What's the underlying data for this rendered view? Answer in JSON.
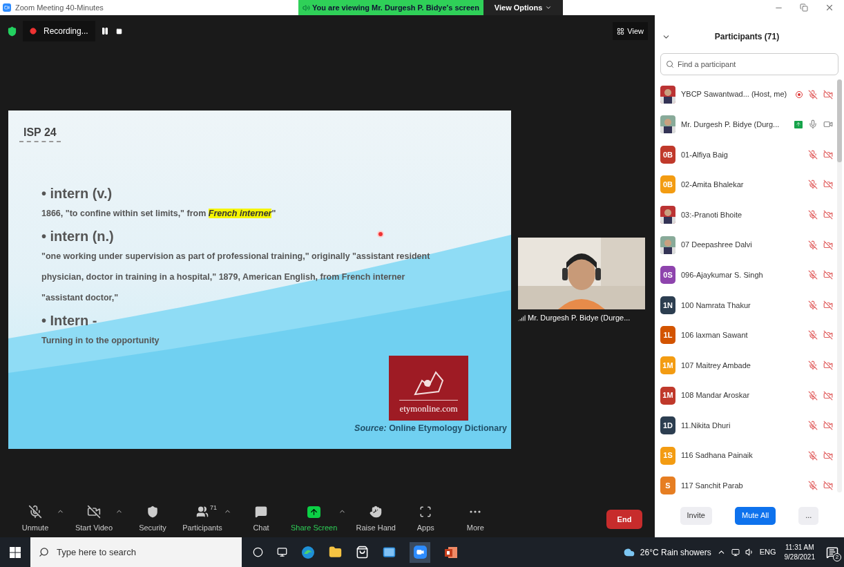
{
  "window": {
    "title": "Zoom Meeting 40-Minutes"
  },
  "banner": {
    "text": "You are viewing Mr. Durgesh P. Bidye's screen",
    "view_options": "View Options"
  },
  "meeting_bar": {
    "recording": "Recording...",
    "view": "View"
  },
  "slide": {
    "tag": "ISP 24",
    "blocks": [
      {
        "kind": "heading",
        "text": "• intern (v.)"
      },
      {
        "kind": "para",
        "before": "1866, \"to confine within set limits,\" from ",
        "highlight": "French interner",
        "after": "\""
      },
      {
        "kind": "heading",
        "text": "• intern (n.)"
      },
      {
        "kind": "para",
        "before": "\"one working under supervision as part of professional training,\" originally \"assistant resident physician, doctor in training in a hospital,\" 1879, American English, from French interner \"assistant doctor,\""
      },
      {
        "kind": "heading",
        "text": "• Intern -"
      },
      {
        "kind": "para",
        "before": "Turning in to the opportunity"
      }
    ],
    "logo_text": "etymonline.com",
    "source": "*Source:* Online Etymology Dictionary"
  },
  "video_tile": {
    "name": "Mr. Durgesh P. Bidye (Durge..."
  },
  "toolbar": [
    {
      "kind": "unmute",
      "label": "Unmute",
      "caret": true
    },
    {
      "kind": "video",
      "label": "Start Video",
      "caret": true
    },
    {
      "kind": "security",
      "label": "Security",
      "caret": false
    },
    {
      "kind": "participants",
      "label": "Participants",
      "count": "71",
      "caret": true
    },
    {
      "kind": "chat",
      "label": "Chat",
      "caret": false
    },
    {
      "kind": "share",
      "label": "Share Screen",
      "caret": true
    },
    {
      "kind": "hand",
      "label": "Raise Hand",
      "caret": false
    },
    {
      "kind": "apps",
      "label": "Apps",
      "caret": false
    },
    {
      "kind": "more",
      "label": "More",
      "caret": false
    }
  ],
  "end_button": "End",
  "participants": {
    "title": "Participants (71)",
    "search": {
      "placeholder": "Find a participant"
    },
    "items": [
      {
        "name": "YBCP Sawantwad... (Host, me)",
        "recording": true,
        "sharing": false,
        "muted": true,
        "video_off": true
      },
      {
        "name": "Mr. Durgesh P. Bidye (Durg...",
        "recording": false,
        "sharing": true,
        "muted": false,
        "video_off": false
      },
      {
        "name": "01-Alfiya Baig",
        "kind": "initials",
        "initials": "0B",
        "color": "#c0392b",
        "recording": false,
        "sharing": false,
        "muted": true,
        "video_off": true
      },
      {
        "name": "02-Amita Bhalekar",
        "kind": "initials",
        "initials": "0B",
        "color": "#f39c12",
        "recording": false,
        "sharing": false,
        "muted": true,
        "video_off": true
      },
      {
        "name": "03:-Pranoti Bhoite",
        "recording": false,
        "sharing": false,
        "muted": true,
        "video_off": true
      },
      {
        "name": "07 Deepashree Dalvi",
        "recording": false,
        "sharing": false,
        "muted": true,
        "video_off": true
      },
      {
        "name": "096-Ajaykumar S. Singh",
        "kind": "initials",
        "initials": "0S",
        "color": "#8e44ad",
        "recording": false,
        "sharing": false,
        "muted": true,
        "video_off": true
      },
      {
        "name": "100 Namrata Thakur",
        "kind": "initials",
        "initials": "1N",
        "color": "#2c3e50",
        "recording": false,
        "sharing": false,
        "muted": true,
        "video_off": true
      },
      {
        "name": "106 laxman Sawant",
        "kind": "initials",
        "initials": "1L",
        "color": "#d35400",
        "recording": false,
        "sharing": false,
        "muted": true,
        "video_off": true
      },
      {
        "name": "107 Maitrey Ambade",
        "kind": "initials",
        "initials": "1M",
        "color": "#f39c12",
        "recording": false,
        "sharing": false,
        "muted": true,
        "video_off": true
      },
      {
        "name": "108 Mandar Aroskar",
        "kind": "initials",
        "initials": "1M",
        "color": "#c0392b",
        "recording": false,
        "sharing": false,
        "muted": true,
        "video_off": true
      },
      {
        "name": "11.Nikita Dhuri",
        "kind": "initials",
        "initials": "1D",
        "color": "#2c3e50",
        "recording": false,
        "sharing": false,
        "muted": true,
        "video_off": true
      },
      {
        "name": "116 Sadhana Painaik",
        "kind": "initials",
        "initials": "1S",
        "color": "#f39c12",
        "recording": false,
        "sharing": false,
        "muted": true,
        "video_off": true
      },
      {
        "name": "117 Sanchit Parab",
        "kind": "initials",
        "initials": "S",
        "color": "#e67e22",
        "recording": false,
        "sharing": false,
        "muted": true,
        "video_off": true
      }
    ],
    "buttons": [
      "Invite",
      "Mute All",
      "..."
    ]
  },
  "taskbar": {
    "search": {
      "placeholder": "Type here to search"
    },
    "weather": "26°C Rain showers",
    "language": "ENG",
    "time": "11:31 AM",
    "date": "9/28/2021",
    "notifications": "2"
  }
}
